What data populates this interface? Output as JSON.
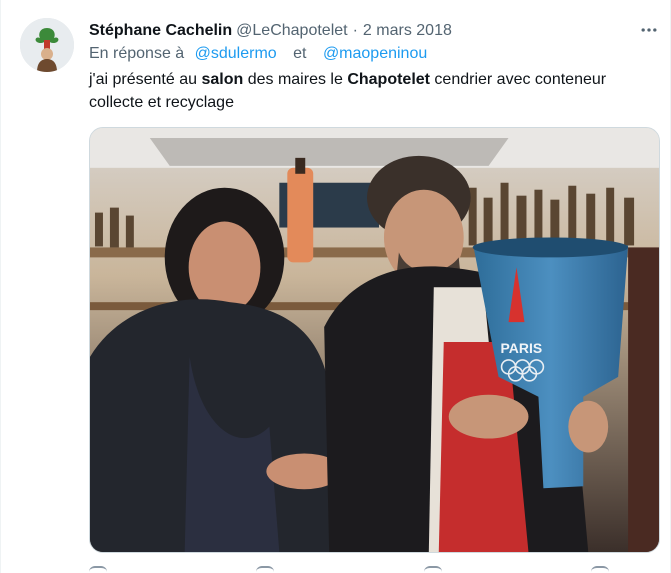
{
  "tweet": {
    "author_name": "Stéphane Cachelin",
    "handle": "@LeChapotelet",
    "separator": "·",
    "date": "2 mars 2018",
    "reply_prefix": "En réponse à",
    "reply_mentions": [
      "@sdulermo",
      "et",
      "@maopeninou"
    ],
    "text_parts": [
      "j'ai présenté au ",
      "salon",
      " des maires le ",
      "Chapotelet",
      " cendrier avec conteneur collecte et recyclage"
    ]
  },
  "media": {
    "object_text": "PARIS",
    "icon": "photo"
  },
  "colors": {
    "link": "#1d9bf0",
    "secondary": "#536471",
    "primary_text": "#0f1419",
    "border": "#cfd9de"
  },
  "icons": {
    "more": "more-dots-icon",
    "reply": "reply-icon",
    "retweet": "retweet-icon",
    "like": "like-icon",
    "share": "share-icon"
  }
}
